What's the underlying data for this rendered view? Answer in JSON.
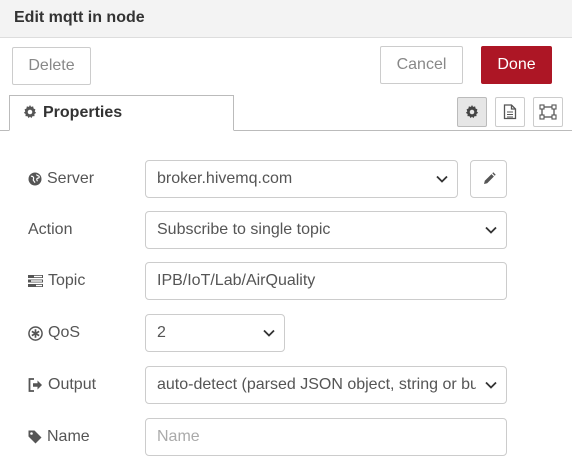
{
  "dialog": {
    "title": "Edit mqtt in node"
  },
  "toolbar": {
    "delete_label": "Delete",
    "cancel_label": "Cancel",
    "done_label": "Done"
  },
  "tabs": {
    "properties_label": "Properties"
  },
  "form": {
    "server": {
      "label": "Server",
      "value": "broker.hivemq.com"
    },
    "action": {
      "label": "Action",
      "value": "Subscribe to single topic"
    },
    "topic": {
      "label": "Topic",
      "value": "IPB/IoT/Lab/AirQuality"
    },
    "qos": {
      "label": "QoS",
      "value": "2"
    },
    "output": {
      "label": "Output",
      "value": "auto-detect (parsed JSON object, string or bu"
    },
    "name": {
      "label": "Name",
      "placeholder": "Name"
    }
  },
  "colors": {
    "done_button": "#ad1625",
    "titlebar_bg": "#f3f3f3"
  },
  "icons": [
    "cog-icon",
    "document-icon",
    "frame-icon",
    "globe-icon",
    "pencil-icon",
    "tasks-icon",
    "asterisk-circle-icon",
    "sign-out-icon",
    "tag-icon",
    "chevron-down-icon"
  ]
}
